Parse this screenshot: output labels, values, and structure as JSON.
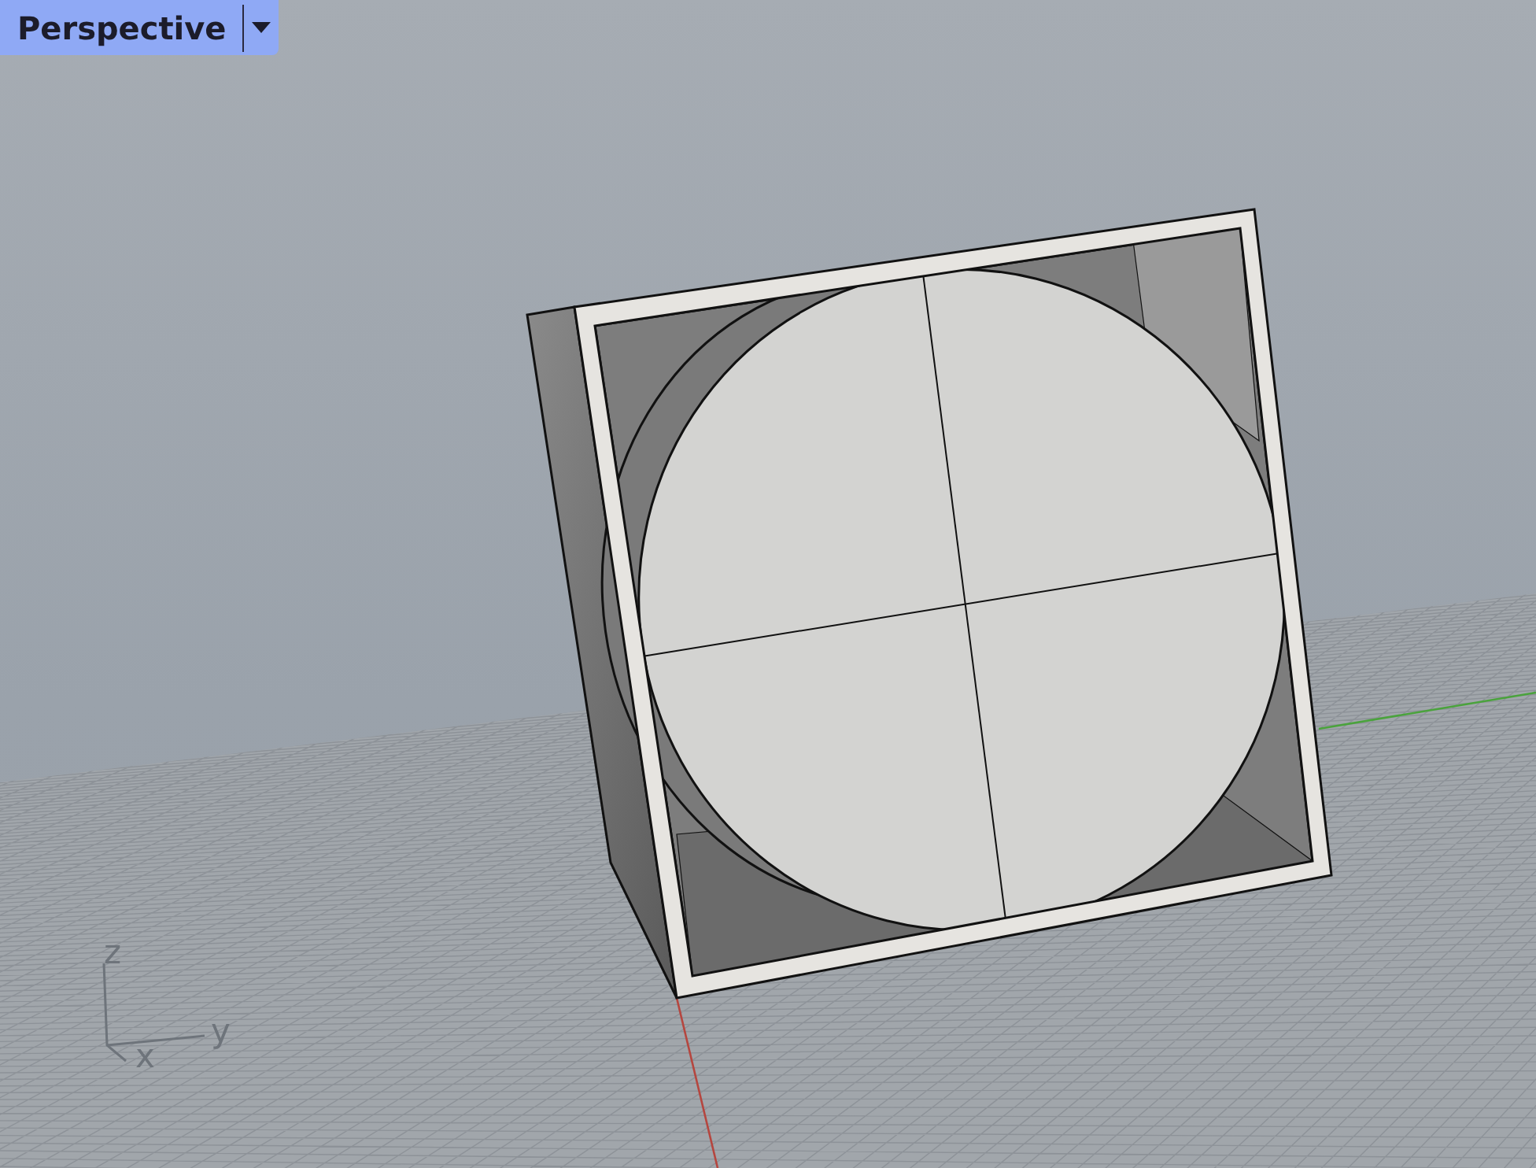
{
  "viewport": {
    "title": "Perspective"
  },
  "axis_labels": [
    "z",
    "x",
    "y"
  ]
}
